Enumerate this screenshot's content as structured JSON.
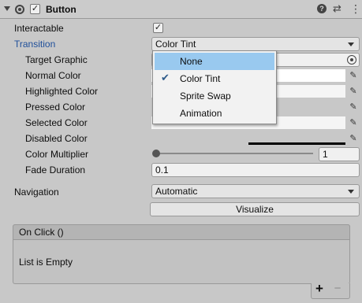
{
  "component": {
    "title": "Button",
    "enabled": true
  },
  "fields": {
    "interactable": {
      "label": "Interactable",
      "checked": true
    },
    "transition": {
      "label": "Transition",
      "value": "Color Tint"
    },
    "target_graphic": {
      "label": "Target Graphic"
    },
    "normal_color": {
      "label": "Normal Color"
    },
    "highlighted_color": {
      "label": "Highlighted Color"
    },
    "pressed_color": {
      "label": "Pressed Color"
    },
    "selected_color": {
      "label": "Selected Color"
    },
    "disabled_color": {
      "label": "Disabled Color"
    },
    "color_multiplier": {
      "label": "Color Multiplier",
      "value": "1",
      "slider_fraction": 0
    },
    "fade_duration": {
      "label": "Fade Duration",
      "value": "0.1"
    },
    "navigation": {
      "label": "Navigation",
      "value": "Automatic"
    },
    "visualize": {
      "label": "Visualize"
    }
  },
  "dropdown": {
    "items": [
      {
        "label": "None",
        "highlighted": true,
        "checked": false
      },
      {
        "label": "Color Tint",
        "highlighted": false,
        "checked": true
      },
      {
        "label": "Sprite Swap",
        "highlighted": false,
        "checked": false
      },
      {
        "label": "Animation",
        "highlighted": false,
        "checked": false
      }
    ]
  },
  "on_click": {
    "title": "On Click ()",
    "empty_text": "List is Empty",
    "add_label": "+",
    "remove_label": "−"
  },
  "icons": {
    "help": "help-icon",
    "presets": "presets-icon",
    "menu": "more-icon"
  },
  "colors": {
    "transition_label": "#1f4f9a",
    "dropdown_highlight": "#99c9ef"
  }
}
